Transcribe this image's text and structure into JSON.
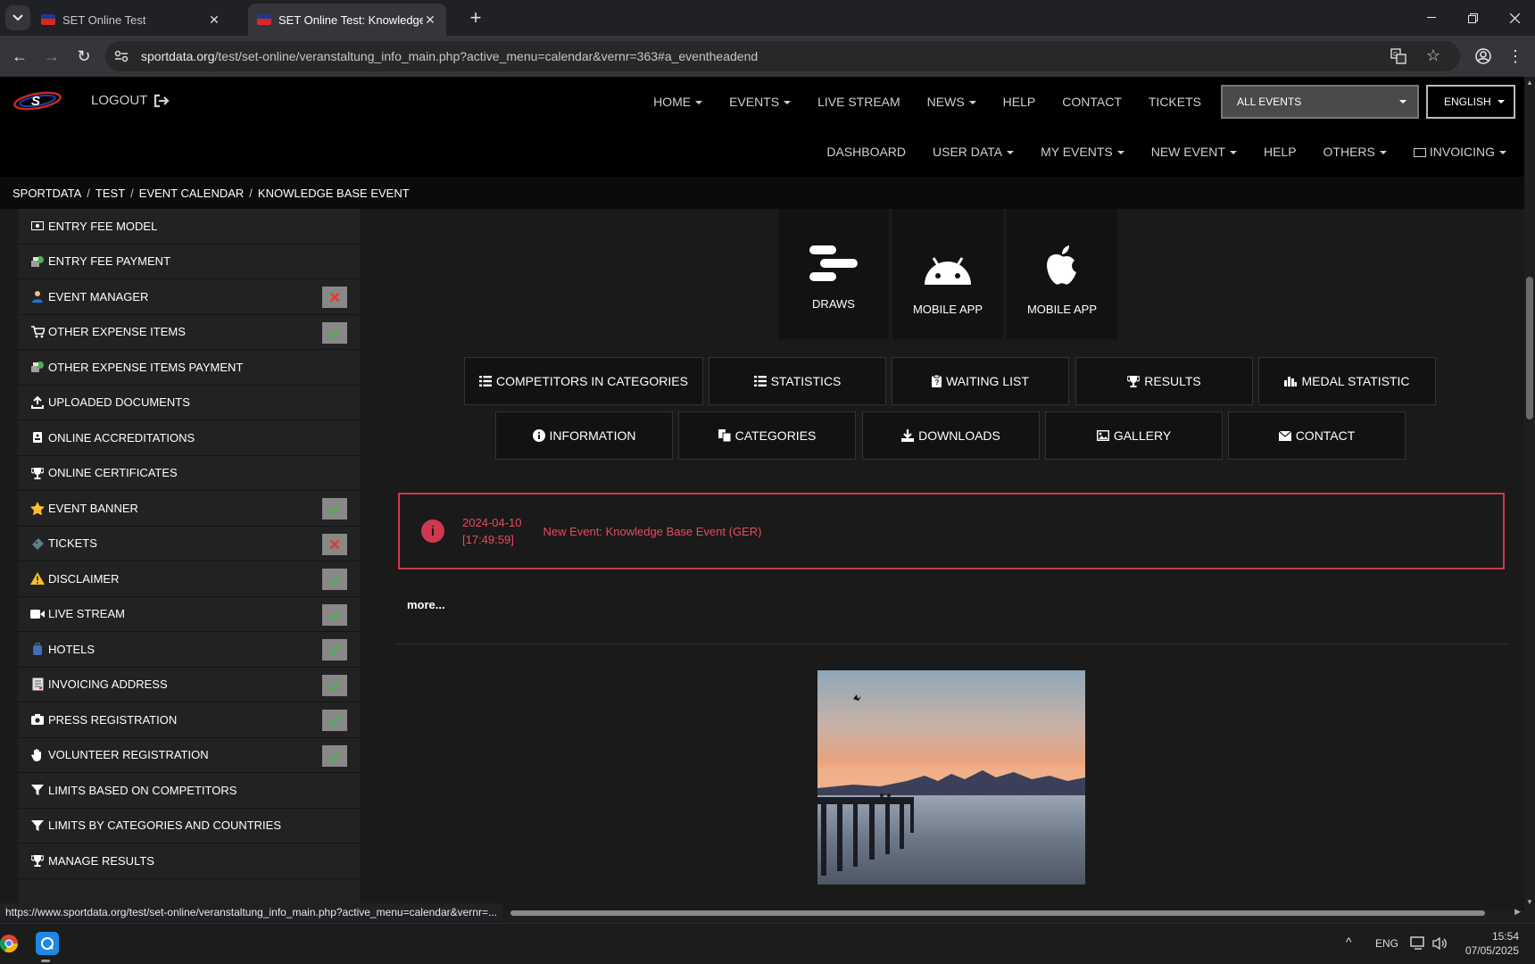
{
  "browser": {
    "tabs": [
      {
        "title": "SET Online Test"
      },
      {
        "title": "SET Online Test: Knowledge Base Event"
      }
    ],
    "url_host": "sportdata.org",
    "url_path": "/test/set-online/veranstaltung_info_main.php?active_menu=calendar&vernr=363#a_eventheadend",
    "status_url": "https://www.sportdata.org/test/set-online/veranstaltung_info_main.php?active_menu=calendar&vernr=..."
  },
  "nav": {
    "logout": "LOGOUT",
    "menu": [
      {
        "label": "HOME",
        "caret": true
      },
      {
        "label": "EVENTS",
        "caret": true
      },
      {
        "label": "LIVE STREAM",
        "caret": false
      },
      {
        "label": "NEWS",
        "caret": true
      },
      {
        "label": "HELP",
        "caret": false
      },
      {
        "label": "CONTACT",
        "caret": false
      },
      {
        "label": "TICKETS",
        "caret": false
      }
    ],
    "event_select": "ALL EVENTS",
    "language_select": "ENGLISH",
    "submenu": [
      {
        "label": "DASHBOARD",
        "caret": false
      },
      {
        "label": "USER DATA",
        "caret": true
      },
      {
        "label": "MY EVENTS",
        "caret": true
      },
      {
        "label": "NEW EVENT",
        "caret": true
      },
      {
        "label": "HELP",
        "caret": false
      },
      {
        "label": "OTHERS",
        "caret": true
      },
      {
        "label": "INVOICING",
        "caret": true
      }
    ]
  },
  "breadcrumb": [
    "SPORTDATA",
    "TEST",
    "EVENT CALENDAR",
    "KNOWLEDGE BASE EVENT"
  ],
  "sidebar": {
    "items": [
      {
        "label": "ENTRY FEE MODEL",
        "icon": "money-icon",
        "status": ""
      },
      {
        "label": "ENTRY FEE PAYMENT",
        "icon": "payment-icon",
        "status": ""
      },
      {
        "label": "EVENT MANAGER",
        "icon": "manager-icon",
        "status": "no"
      },
      {
        "label": "OTHER EXPENSE ITEMS",
        "icon": "cart-icon",
        "status": "yes"
      },
      {
        "label": "OTHER EXPENSE ITEMS PAYMENT",
        "icon": "payment-icon",
        "status": ""
      },
      {
        "label": "UPLOADED DOCUMENTS",
        "icon": "upload-icon",
        "status": ""
      },
      {
        "label": "ONLINE ACCREDITATIONS",
        "icon": "badge-icon",
        "status": ""
      },
      {
        "label": "ONLINE CERTIFICATES",
        "icon": "trophy-icon",
        "status": ""
      },
      {
        "label": "EVENT BANNER",
        "icon": "star-icon",
        "status": "yes"
      },
      {
        "label": "TICKETS",
        "icon": "ticket-icon",
        "status": "no"
      },
      {
        "label": "DISCLAIMER",
        "icon": "warning-icon",
        "status": "yes"
      },
      {
        "label": "LIVE STREAM",
        "icon": "video-icon",
        "status": "yes"
      },
      {
        "label": "HOTELS",
        "icon": "luggage-icon",
        "status": "yes"
      },
      {
        "label": "INVOICING ADDRESS",
        "icon": "invoice-icon",
        "status": "yes"
      },
      {
        "label": "PRESS REGISTRATION",
        "icon": "camera-icon",
        "status": "yes"
      },
      {
        "label": "VOLUNTEER REGISTRATION",
        "icon": "hand-icon",
        "status": "yes"
      },
      {
        "label": "LIMITS BASED ON COMPETITORS",
        "icon": "filter-icon",
        "status": ""
      },
      {
        "label": "LIMITS BY CATEGORIES AND COUNTRIES",
        "icon": "filter-icon",
        "status": ""
      },
      {
        "label": "MANAGE RESULTS",
        "icon": "trophy-icon",
        "status": ""
      }
    ]
  },
  "apps": [
    {
      "label": "DRAWS",
      "icon": "draws-icon"
    },
    {
      "label": "MOBILE APP",
      "icon": "android-icon"
    },
    {
      "label": "MOBILE APP",
      "icon": "apple-icon"
    }
  ],
  "buttons_row1": [
    {
      "label": "COMPETITORS IN CATEGORIES",
      "icon": "list-icon"
    },
    {
      "label": "STATISTICS",
      "icon": "list-icon"
    },
    {
      "label": "WAITING LIST",
      "icon": "clipboard-icon"
    },
    {
      "label": "RESULTS",
      "icon": "trophy-icon"
    },
    {
      "label": "MEDAL STATISTIC",
      "icon": "bar-chart-icon"
    }
  ],
  "buttons_row2": [
    {
      "label": "INFORMATION",
      "icon": "info-icon"
    },
    {
      "label": "CATEGORIES",
      "icon": "copy-icon"
    },
    {
      "label": "DOWNLOADS",
      "icon": "download-icon"
    },
    {
      "label": "GALLERY",
      "icon": "image-icon"
    },
    {
      "label": "CONTACT",
      "icon": "envelope-icon"
    }
  ],
  "notice": {
    "date": "2024-04-10",
    "time": "[17:49:59]",
    "message": "New Event: Knowledge Base Event (GER)"
  },
  "more_link": "more...",
  "taskbar": {
    "lang": "ENG",
    "time": "15:54",
    "date": "07/05/2025"
  },
  "colors": {
    "accent_red": "#d03850",
    "check_green": "#4caf50",
    "cross_red": "#e53935"
  }
}
